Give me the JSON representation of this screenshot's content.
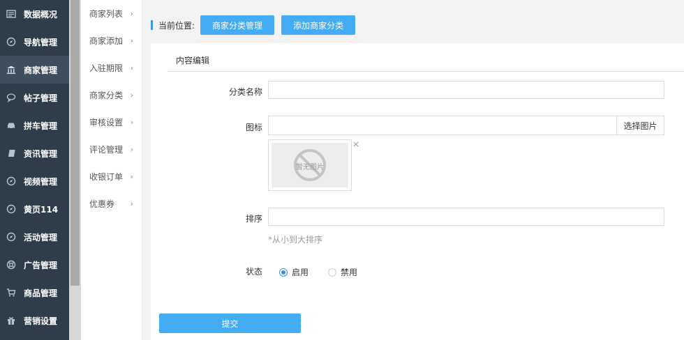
{
  "sidebar": {
    "items": [
      {
        "label": "数据概况",
        "icon": "dashboard-icon"
      },
      {
        "label": "导航管理",
        "icon": "compass-icon"
      },
      {
        "label": "商家管理",
        "icon": "bank-icon",
        "active": true
      },
      {
        "label": "帖子管理",
        "icon": "chat-bubble-icon"
      },
      {
        "label": "拼车管理",
        "icon": "car-icon"
      },
      {
        "label": "资讯管理",
        "icon": "book-icon"
      },
      {
        "label": "视频管理",
        "icon": "compass-icon"
      },
      {
        "label": "黄页114",
        "icon": "compass-icon"
      },
      {
        "label": "活动管理",
        "icon": "compass-icon"
      },
      {
        "label": "广告管理",
        "icon": "lifebuoy-icon"
      },
      {
        "label": "商品管理",
        "icon": "cart-icon"
      },
      {
        "label": "营销设置",
        "icon": "gift-icon"
      }
    ]
  },
  "submenu": {
    "items": [
      {
        "label": "商家列表"
      },
      {
        "label": "商家添加"
      },
      {
        "label": "入驻期限"
      },
      {
        "label": "商家分类"
      },
      {
        "label": "审核设置"
      },
      {
        "label": "评论管理"
      },
      {
        "label": "收银订单"
      },
      {
        "label": "优惠券"
      }
    ],
    "arrow": "›"
  },
  "breadcrumb": {
    "label": "当前位置:",
    "buttons": [
      "商家分类管理",
      "添加商家分类"
    ]
  },
  "panel": {
    "tab_label": "内容编辑"
  },
  "form": {
    "name_label": "分类名称",
    "name_value": "",
    "icon_label": "图标",
    "icon_value": "",
    "pick_image_label": "选择图片",
    "no_image_text": "暂无图片",
    "close_symbol": "×",
    "sort_label": "排序",
    "sort_value": "",
    "sort_hint": "*从小到大排序",
    "status_label": "状态",
    "status_options": [
      {
        "label": "启用",
        "checked": true
      },
      {
        "label": "禁用",
        "checked": false
      }
    ],
    "submit_label": "提交"
  },
  "colors": {
    "sidebar_bg": "#2f3d4b",
    "accent": "#44acf5",
    "radio_on": "#3b8ee0"
  }
}
